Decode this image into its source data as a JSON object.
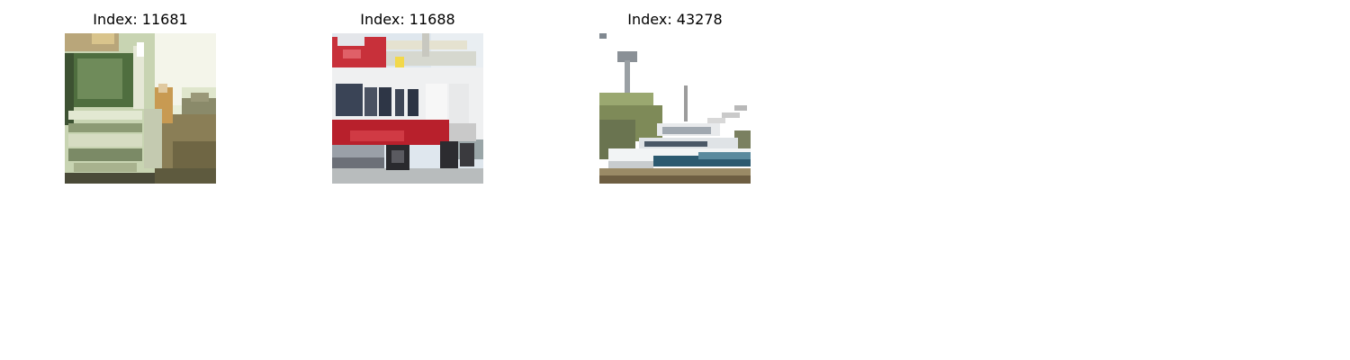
{
  "panels": [
    {
      "title": "Index: 11681",
      "subject": "truck"
    },
    {
      "title": "Index: 11688",
      "subject": "fire-truck"
    },
    {
      "title": "Index: 43278",
      "subject": "boat"
    }
  ]
}
